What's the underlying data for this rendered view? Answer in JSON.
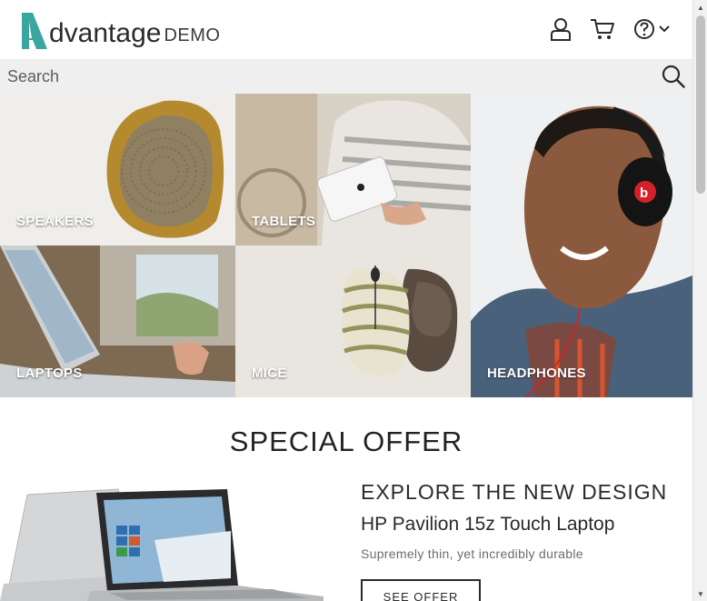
{
  "brand": {
    "logo_word": "dvantage",
    "logo_suffix": "DEMO",
    "accent": "#3ba6a0"
  },
  "header": {
    "icons": {
      "user": "user-icon",
      "cart": "cart-icon",
      "help": "help-icon",
      "menu": "chevron-down-icon"
    }
  },
  "search": {
    "placeholder": "Search",
    "value": "",
    "icon": "search-icon"
  },
  "categories": [
    {
      "label": "SPEAKERS"
    },
    {
      "label": "TABLETS"
    },
    {
      "label": "HEADPHONES"
    },
    {
      "label": "LAPTOPS"
    },
    {
      "label": "MICE"
    }
  ],
  "special_offer": {
    "title": "SPECIAL OFFER",
    "headline": "EXPLORE THE NEW DESIGN",
    "product": "HP Pavilion 15z Touch Laptop",
    "tagline": "Supremely thin, yet incredibly durable",
    "cta": "SEE OFFER"
  }
}
